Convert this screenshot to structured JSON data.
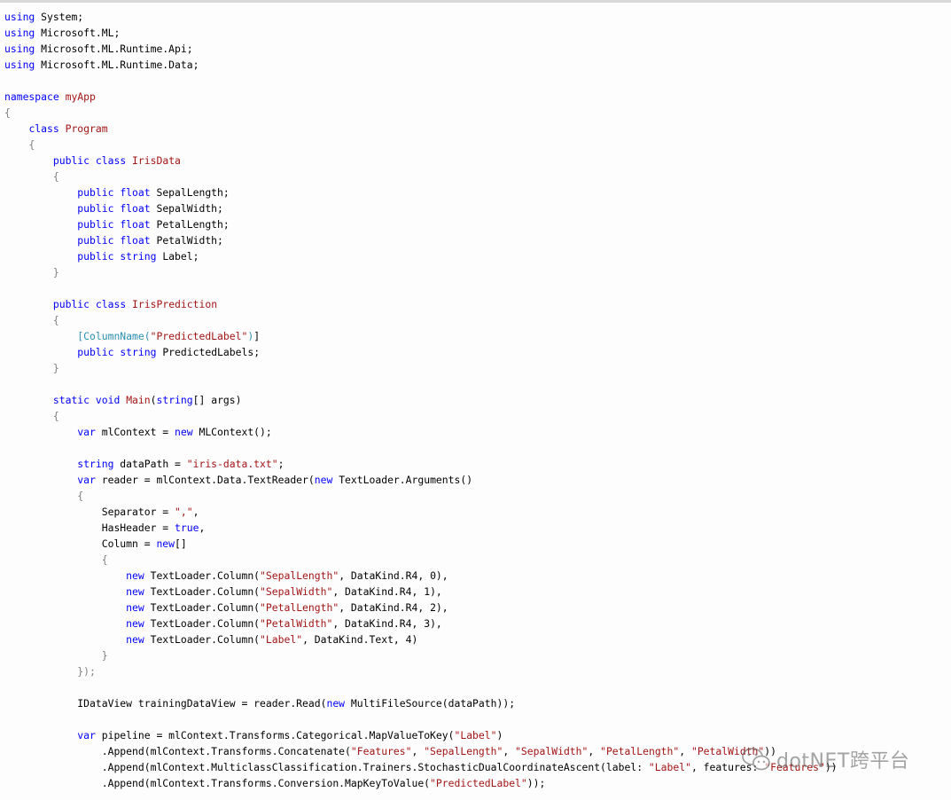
{
  "code": {
    "language": "csharp",
    "lines": [
      [
        [
          "kw",
          "using"
        ],
        [
          "txt",
          " System;"
        ]
      ],
      [
        [
          "kw",
          "using"
        ],
        [
          "txt",
          " Microsoft.ML;"
        ]
      ],
      [
        [
          "kw",
          "using"
        ],
        [
          "txt",
          " Microsoft.ML.Runtime.Api;"
        ]
      ],
      [
        [
          "kw",
          "using"
        ],
        [
          "txt",
          " Microsoft.ML.Runtime.Data;"
        ]
      ],
      [],
      [
        [
          "kw",
          "namespace"
        ],
        [
          "txt",
          " "
        ],
        [
          "type",
          "myApp"
        ]
      ],
      [
        [
          "brace",
          "{"
        ]
      ],
      [
        [
          "txt",
          "    "
        ],
        [
          "kw",
          "class"
        ],
        [
          "txt",
          " "
        ],
        [
          "type",
          "Program"
        ]
      ],
      [
        [
          "txt",
          "    "
        ],
        [
          "brace",
          "{"
        ]
      ],
      [
        [
          "txt",
          "        "
        ],
        [
          "kw",
          "public"
        ],
        [
          "txt",
          " "
        ],
        [
          "kw",
          "class"
        ],
        [
          "txt",
          " "
        ],
        [
          "type",
          "IrisData"
        ]
      ],
      [
        [
          "txt",
          "        "
        ],
        [
          "brace",
          "{"
        ]
      ],
      [
        [
          "txt",
          "            "
        ],
        [
          "kw",
          "public"
        ],
        [
          "txt",
          " "
        ],
        [
          "kw",
          "float"
        ],
        [
          "txt",
          " SepalLength;"
        ]
      ],
      [
        [
          "txt",
          "            "
        ],
        [
          "kw",
          "public"
        ],
        [
          "txt",
          " "
        ],
        [
          "kw",
          "float"
        ],
        [
          "txt",
          " SepalWidth;"
        ]
      ],
      [
        [
          "txt",
          "            "
        ],
        [
          "kw",
          "public"
        ],
        [
          "txt",
          " "
        ],
        [
          "kw",
          "float"
        ],
        [
          "txt",
          " PetalLength;"
        ]
      ],
      [
        [
          "txt",
          "            "
        ],
        [
          "kw",
          "public"
        ],
        [
          "txt",
          " "
        ],
        [
          "kw",
          "float"
        ],
        [
          "txt",
          " PetalWidth;"
        ]
      ],
      [
        [
          "txt",
          "            "
        ],
        [
          "kw",
          "public"
        ],
        [
          "txt",
          " "
        ],
        [
          "kw",
          "string"
        ],
        [
          "txt",
          " Label;"
        ]
      ],
      [
        [
          "txt",
          "        "
        ],
        [
          "brace",
          "}"
        ]
      ],
      [],
      [
        [
          "txt",
          "        "
        ],
        [
          "kw",
          "public"
        ],
        [
          "txt",
          " "
        ],
        [
          "kw",
          "class"
        ],
        [
          "txt",
          " "
        ],
        [
          "type",
          "IrisPrediction"
        ]
      ],
      [
        [
          "txt",
          "        "
        ],
        [
          "brace",
          "{"
        ]
      ],
      [
        [
          "txt",
          "            "
        ],
        [
          "attr",
          "[ColumnName("
        ],
        [
          "str",
          "\"PredictedLabel\""
        ],
        [
          "attr",
          ")"
        ],
        [
          "txt",
          "]"
        ]
      ],
      [
        [
          "txt",
          "            "
        ],
        [
          "kw",
          "public"
        ],
        [
          "txt",
          " "
        ],
        [
          "kw",
          "string"
        ],
        [
          "txt",
          " PredictedLabels;"
        ]
      ],
      [
        [
          "txt",
          "        "
        ],
        [
          "brace",
          "}"
        ]
      ],
      [],
      [
        [
          "txt",
          "        "
        ],
        [
          "kw",
          "static"
        ],
        [
          "txt",
          " "
        ],
        [
          "kw",
          "void"
        ],
        [
          "txt",
          " "
        ],
        [
          "type",
          "Main"
        ],
        [
          "txt",
          "("
        ],
        [
          "kw",
          "string"
        ],
        [
          "txt",
          "[] args)"
        ]
      ],
      [
        [
          "txt",
          "        "
        ],
        [
          "brace",
          "{"
        ]
      ],
      [
        [
          "txt",
          "            "
        ],
        [
          "kw",
          "var"
        ],
        [
          "txt",
          " mlContext = "
        ],
        [
          "kw",
          "new"
        ],
        [
          "txt",
          " MLContext();"
        ]
      ],
      [],
      [
        [
          "txt",
          "            "
        ],
        [
          "kw",
          "string"
        ],
        [
          "txt",
          " dataPath = "
        ],
        [
          "str",
          "\"iris-data.txt\""
        ],
        [
          "txt",
          ";"
        ]
      ],
      [
        [
          "txt",
          "            "
        ],
        [
          "kw",
          "var"
        ],
        [
          "txt",
          " reader = mlContext.Data.TextReader("
        ],
        [
          "kw",
          "new"
        ],
        [
          "txt",
          " TextLoader.Arguments()"
        ]
      ],
      [
        [
          "txt",
          "            "
        ],
        [
          "brace",
          "{"
        ]
      ],
      [
        [
          "txt",
          "                Separator = "
        ],
        [
          "str",
          "\",\""
        ],
        [
          "txt",
          ","
        ]
      ],
      [
        [
          "txt",
          "                HasHeader = "
        ],
        [
          "kw",
          "true"
        ],
        [
          "txt",
          ","
        ]
      ],
      [
        [
          "txt",
          "                Column = "
        ],
        [
          "kw",
          "new"
        ],
        [
          "txt",
          "[]"
        ]
      ],
      [
        [
          "txt",
          "                "
        ],
        [
          "brace",
          "{"
        ]
      ],
      [
        [
          "txt",
          "                    "
        ],
        [
          "kw",
          "new"
        ],
        [
          "txt",
          " TextLoader.Column("
        ],
        [
          "str",
          "\"SepalLength\""
        ],
        [
          "txt",
          ", DataKind.R4, 0),"
        ]
      ],
      [
        [
          "txt",
          "                    "
        ],
        [
          "kw",
          "new"
        ],
        [
          "txt",
          " TextLoader.Column("
        ],
        [
          "str",
          "\"SepalWidth\""
        ],
        [
          "txt",
          ", DataKind.R4, 1),"
        ]
      ],
      [
        [
          "txt",
          "                    "
        ],
        [
          "kw",
          "new"
        ],
        [
          "txt",
          " TextLoader.Column("
        ],
        [
          "str",
          "\"PetalLength\""
        ],
        [
          "txt",
          ", DataKind.R4, 2),"
        ]
      ],
      [
        [
          "txt",
          "                    "
        ],
        [
          "kw",
          "new"
        ],
        [
          "txt",
          " TextLoader.Column("
        ],
        [
          "str",
          "\"PetalWidth\""
        ],
        [
          "txt",
          ", DataKind.R4, 3),"
        ]
      ],
      [
        [
          "txt",
          "                    "
        ],
        [
          "kw",
          "new"
        ],
        [
          "txt",
          " TextLoader.Column("
        ],
        [
          "str",
          "\"Label\""
        ],
        [
          "txt",
          ", DataKind.Text, 4)"
        ]
      ],
      [
        [
          "txt",
          "                "
        ],
        [
          "brace",
          "}"
        ]
      ],
      [
        [
          "txt",
          "            "
        ],
        [
          "brace",
          "});"
        ]
      ],
      [],
      [
        [
          "txt",
          "            IDataView trainingDataView = reader.Read("
        ],
        [
          "kw",
          "new"
        ],
        [
          "txt",
          " MultiFileSource(dataPath));"
        ]
      ],
      [],
      [
        [
          "txt",
          "            "
        ],
        [
          "kw",
          "var"
        ],
        [
          "txt",
          " pipeline = mlContext.Transforms.Categorical.MapValueToKey("
        ],
        [
          "str",
          "\"Label\""
        ],
        [
          "txt",
          ")"
        ]
      ],
      [
        [
          "txt",
          "                .Append(mlContext.Transforms.Concatenate("
        ],
        [
          "str",
          "\"Features\""
        ],
        [
          "txt",
          ", "
        ],
        [
          "str",
          "\"SepalLength\""
        ],
        [
          "txt",
          ", "
        ],
        [
          "str",
          "\"SepalWidth\""
        ],
        [
          "txt",
          ", "
        ],
        [
          "str",
          "\"PetalLength\""
        ],
        [
          "txt",
          ", "
        ],
        [
          "str",
          "\"PetalWidth\""
        ],
        [
          "txt",
          "))"
        ]
      ],
      [
        [
          "txt",
          "                .Append(mlContext.MulticlassClassification.Trainers.StochasticDualCoordinateAscent(label: "
        ],
        [
          "str",
          "\"Label\""
        ],
        [
          "txt",
          ", features: "
        ],
        [
          "str",
          "\"Features\""
        ],
        [
          "txt",
          "))"
        ]
      ],
      [
        [
          "txt",
          "                .Append(mlContext.Transforms.Conversion.MapKeyToValue("
        ],
        [
          "str",
          "\"PredictedLabel\""
        ],
        [
          "txt",
          "));"
        ]
      ]
    ]
  },
  "watermark": {
    "icon": "wechat-icon",
    "text": "dotNET跨平台"
  }
}
